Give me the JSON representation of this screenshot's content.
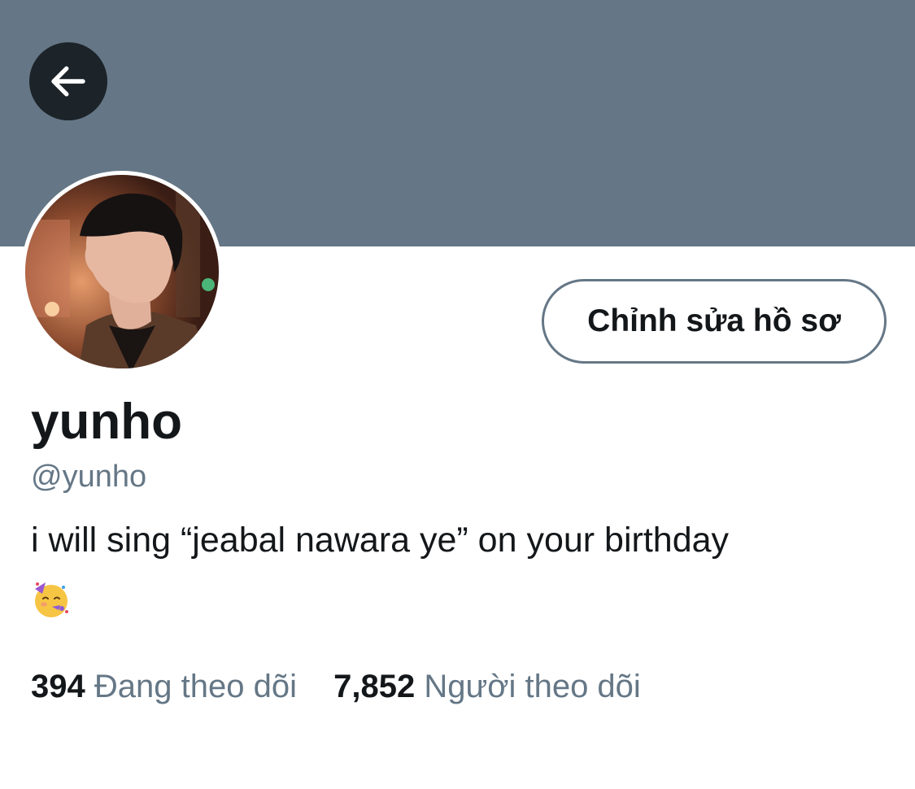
{
  "header": {
    "back_icon": "arrow-left-icon",
    "banner_color": "#657786"
  },
  "profile": {
    "avatar_icon": "avatar-photo",
    "edit_button_label": "Chỉnh sửa hồ sơ",
    "display_name": "yunho",
    "handle": "@yunho",
    "bio": "i will sing “jeabal nawara ye” on your birthday",
    "bio_emoji_icon": "partying-face-emoji"
  },
  "stats": {
    "following_count": "394",
    "following_label": "Đang theo dõi",
    "followers_count": "7,852",
    "followers_label": "Người theo dõi"
  },
  "colors": {
    "text_primary": "#14171a",
    "text_secondary": "#657786"
  }
}
